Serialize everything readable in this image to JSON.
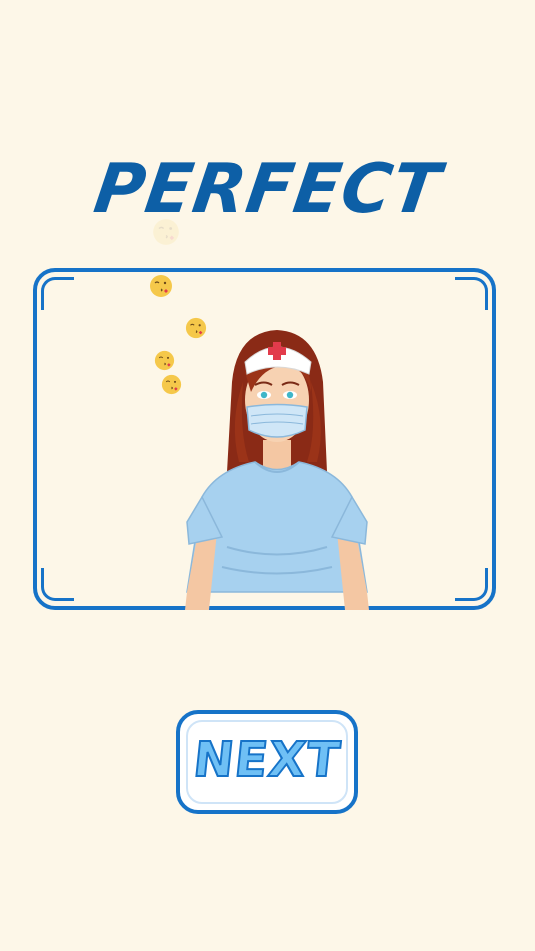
{
  "result": {
    "title": "PERFECT"
  },
  "scene": {
    "character": "nurse-with-mask",
    "emoji_icon": "kiss-emoji-icon"
  },
  "buttons": {
    "next_label": "NEXT"
  },
  "colors": {
    "background": "#fdf7e8",
    "accent": "#1673c8",
    "title": "#0d5fa6",
    "button_fill": "#6fc0f5"
  }
}
